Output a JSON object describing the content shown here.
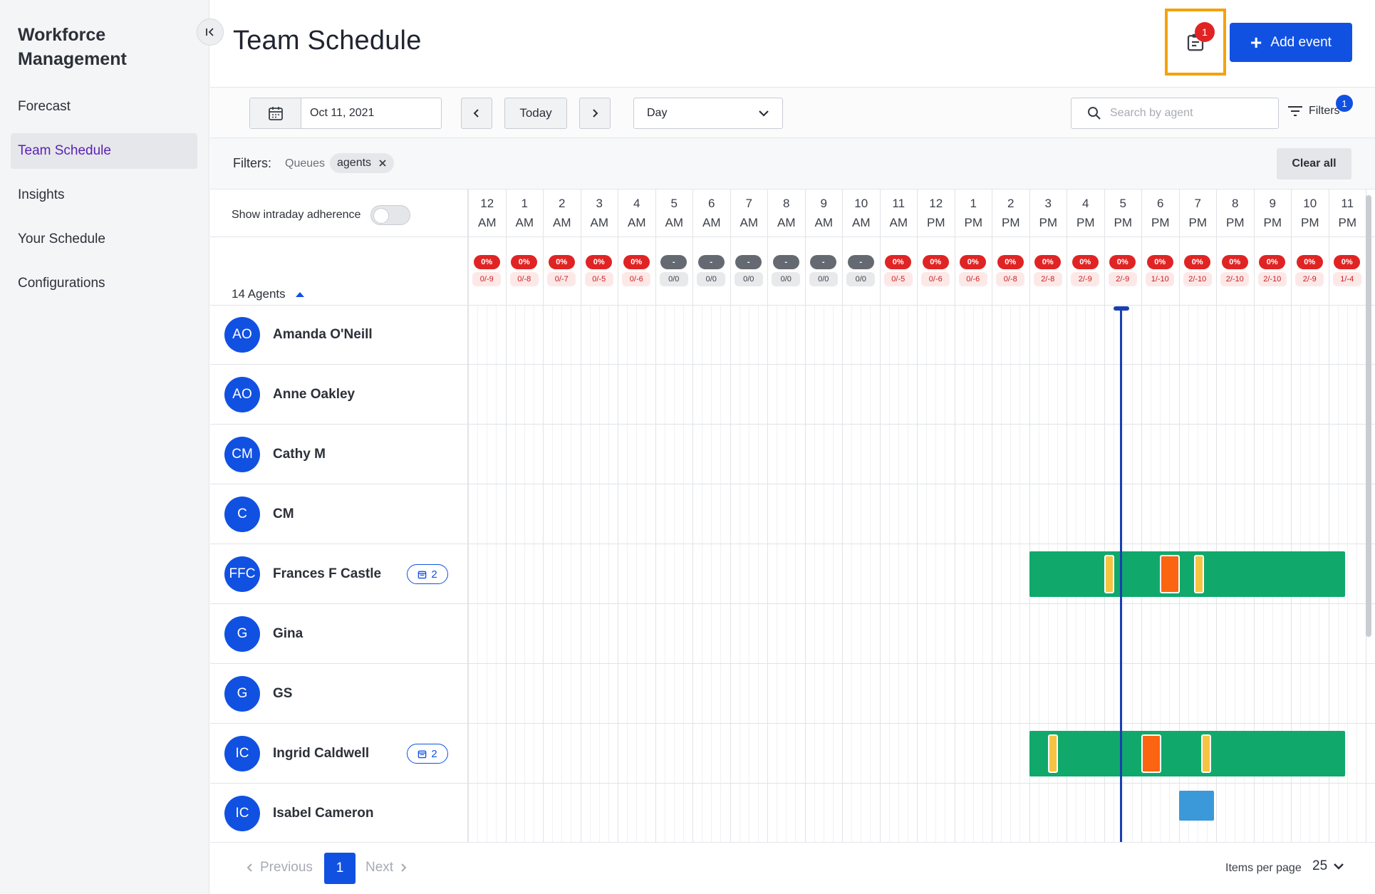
{
  "app": {
    "brand": "Workforce Management"
  },
  "sidebar": {
    "items": [
      {
        "label": "Forecast",
        "active": false
      },
      {
        "label": "Team Schedule",
        "active": true
      },
      {
        "label": "Insights",
        "active": false
      },
      {
        "label": "Your Schedule",
        "active": false
      },
      {
        "label": "Configurations",
        "active": false
      }
    ]
  },
  "header": {
    "title": "Team Schedule",
    "notification_count": "1",
    "add_event_label": "Add event",
    "icons": {
      "notifications": "clipboard-icon",
      "add": "plus-icon",
      "collapse": "collapse-left-icon"
    }
  },
  "toolbar": {
    "date_value": "Oct 11, 2021",
    "today_label": "Today",
    "view_value": "Day",
    "search_placeholder": "Search by agent",
    "filters_label": "Filters",
    "filters_count": "1"
  },
  "filter_bar": {
    "label": "Filters:",
    "key": "Queues",
    "chip": "agents",
    "clear_all_label": "Clear all"
  },
  "grid": {
    "adherence_label": "Show intraday adherence",
    "agents_count_label": "14 Agents",
    "hours": [
      {
        "h": "12",
        "p": "AM"
      },
      {
        "h": "1",
        "p": "AM"
      },
      {
        "h": "2",
        "p": "AM"
      },
      {
        "h": "3",
        "p": "AM"
      },
      {
        "h": "4",
        "p": "AM"
      },
      {
        "h": "5",
        "p": "AM"
      },
      {
        "h": "6",
        "p": "AM"
      },
      {
        "h": "7",
        "p": "AM"
      },
      {
        "h": "8",
        "p": "AM"
      },
      {
        "h": "9",
        "p": "AM"
      },
      {
        "h": "10",
        "p": "AM"
      },
      {
        "h": "11",
        "p": "AM"
      },
      {
        "h": "12",
        "p": "PM"
      },
      {
        "h": "1",
        "p": "PM"
      },
      {
        "h": "2",
        "p": "PM"
      },
      {
        "h": "3",
        "p": "PM"
      },
      {
        "h": "4",
        "p": "PM"
      },
      {
        "h": "5",
        "p": "PM"
      },
      {
        "h": "6",
        "p": "PM"
      },
      {
        "h": "7",
        "p": "PM"
      },
      {
        "h": "8",
        "p": "PM"
      },
      {
        "h": "9",
        "p": "PM"
      },
      {
        "h": "10",
        "p": "PM"
      },
      {
        "h": "11",
        "p": "PM"
      }
    ],
    "hour_stats": [
      {
        "pct": "0%",
        "ratio": "0/-9",
        "state": "red"
      },
      {
        "pct": "0%",
        "ratio": "0/-8",
        "state": "red"
      },
      {
        "pct": "0%",
        "ratio": "0/-7",
        "state": "red"
      },
      {
        "pct": "0%",
        "ratio": "0/-5",
        "state": "red"
      },
      {
        "pct": "0%",
        "ratio": "0/-6",
        "state": "red"
      },
      {
        "pct": "-",
        "ratio": "0/0",
        "state": "grey"
      },
      {
        "pct": "-",
        "ratio": "0/0",
        "state": "grey"
      },
      {
        "pct": "-",
        "ratio": "0/0",
        "state": "grey"
      },
      {
        "pct": "-",
        "ratio": "0/0",
        "state": "grey"
      },
      {
        "pct": "-",
        "ratio": "0/0",
        "state": "grey"
      },
      {
        "pct": "-",
        "ratio": "0/0",
        "state": "grey"
      },
      {
        "pct": "0%",
        "ratio": "0/-5",
        "state": "red"
      },
      {
        "pct": "0%",
        "ratio": "0/-6",
        "state": "red"
      },
      {
        "pct": "0%",
        "ratio": "0/-6",
        "state": "red"
      },
      {
        "pct": "0%",
        "ratio": "0/-8",
        "state": "red"
      },
      {
        "pct": "0%",
        "ratio": "2/-8",
        "state": "red"
      },
      {
        "pct": "0%",
        "ratio": "2/-9",
        "state": "red"
      },
      {
        "pct": "0%",
        "ratio": "2/-9",
        "state": "red"
      },
      {
        "pct": "0%",
        "ratio": "1/-10",
        "state": "red"
      },
      {
        "pct": "0%",
        "ratio": "2/-10",
        "state": "red"
      },
      {
        "pct": "0%",
        "ratio": "2/-10",
        "state": "red"
      },
      {
        "pct": "0%",
        "ratio": "2/-10",
        "state": "red"
      },
      {
        "pct": "0%",
        "ratio": "2/-9",
        "state": "red"
      },
      {
        "pct": "0%",
        "ratio": "1/-4",
        "state": "red"
      }
    ],
    "agents": [
      {
        "initials": "AO",
        "name": "Amanda O'Neill",
        "events": null,
        "schedule": null
      },
      {
        "initials": "AO",
        "name": "Anne Oakley",
        "events": null,
        "schedule": null
      },
      {
        "initials": "CM",
        "name": "Cathy M",
        "events": null,
        "schedule": null
      },
      {
        "initials": "C",
        "name": "CM",
        "events": null,
        "schedule": null
      },
      {
        "initials": "FFC",
        "name": "Frances F Castle",
        "events": "2",
        "schedule": {
          "shift": [
            15.0,
            23.45
          ],
          "breaks": [
            17.0,
            19.4
          ],
          "lunch": 18.5
        }
      },
      {
        "initials": "G",
        "name": "Gina",
        "events": null,
        "schedule": null
      },
      {
        "initials": "G",
        "name": "GS",
        "events": null,
        "schedule": null
      },
      {
        "initials": "IC",
        "name": "Ingrid Caldwell",
        "events": "2",
        "schedule": {
          "shift": [
            15.0,
            23.45
          ],
          "breaks": [
            15.5,
            19.6
          ],
          "lunch": 18.0
        }
      },
      {
        "initials": "IC",
        "name": "Isabel Cameron",
        "events": null,
        "schedule": {
          "meeting": [
            19.0,
            19.95
          ]
        }
      }
    ],
    "current_time_hour": 17.45,
    "colors": {
      "shift": "#10a96b",
      "break": "#f6c343",
      "lunch": "#fb6410",
      "meeting": "#3b99d9",
      "accent": "#1151e2"
    }
  },
  "pagination": {
    "prev_label": "Previous",
    "current_page": "1",
    "next_label": "Next",
    "items_per_page_label": "Items per page",
    "items_per_page_value": "25"
  }
}
